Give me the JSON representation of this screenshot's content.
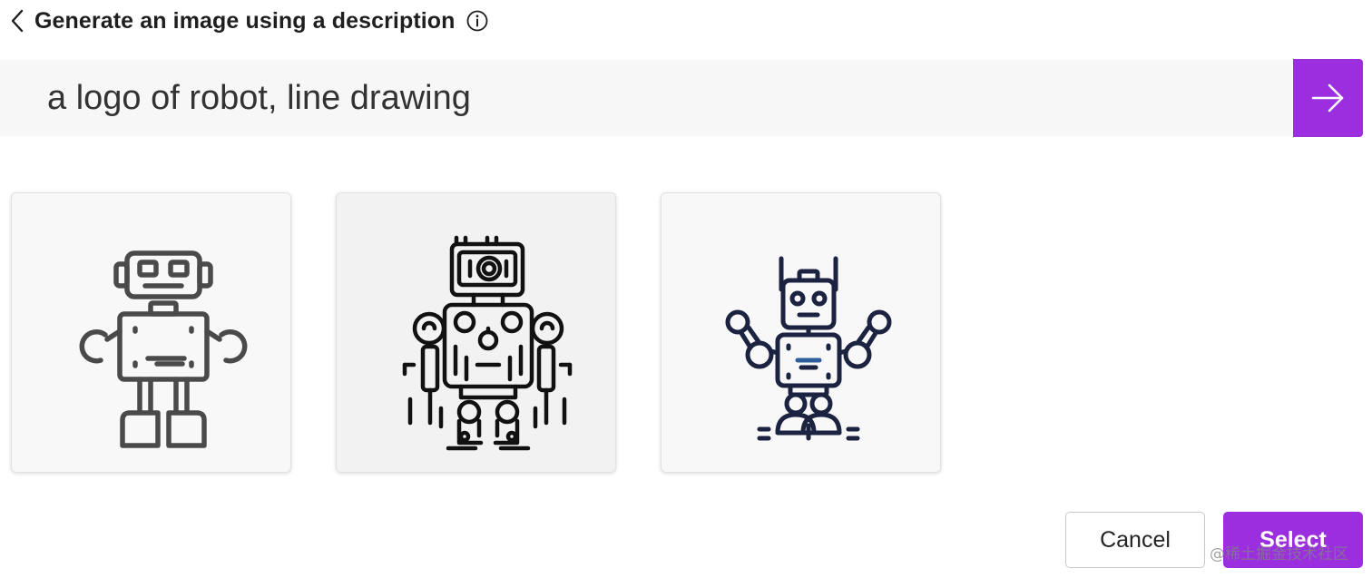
{
  "header": {
    "title": "Generate an image using a description",
    "back_icon": "chevron-left-icon",
    "info_icon": "info-icon"
  },
  "prompt": {
    "value": "a logo of robot, line drawing",
    "submit_icon": "arrow-right-icon"
  },
  "images": [
    {
      "label": "robot-image-1",
      "style": "simple gray line robot"
    },
    {
      "label": "robot-image-2",
      "style": "detailed black line robot"
    },
    {
      "label": "robot-image-3",
      "style": "navy line robot with raised arms"
    }
  ],
  "footer": {
    "cancel_label": "Cancel",
    "select_label": "Select"
  },
  "watermark": "@稀土掘金技术社区",
  "colors": {
    "accent": "#9b2fe0",
    "prompt_bg": "#f7f7f7",
    "robot1_stroke": "#4a4a4a",
    "robot2_stroke": "#111111",
    "robot3_stroke": "#1c2340"
  }
}
